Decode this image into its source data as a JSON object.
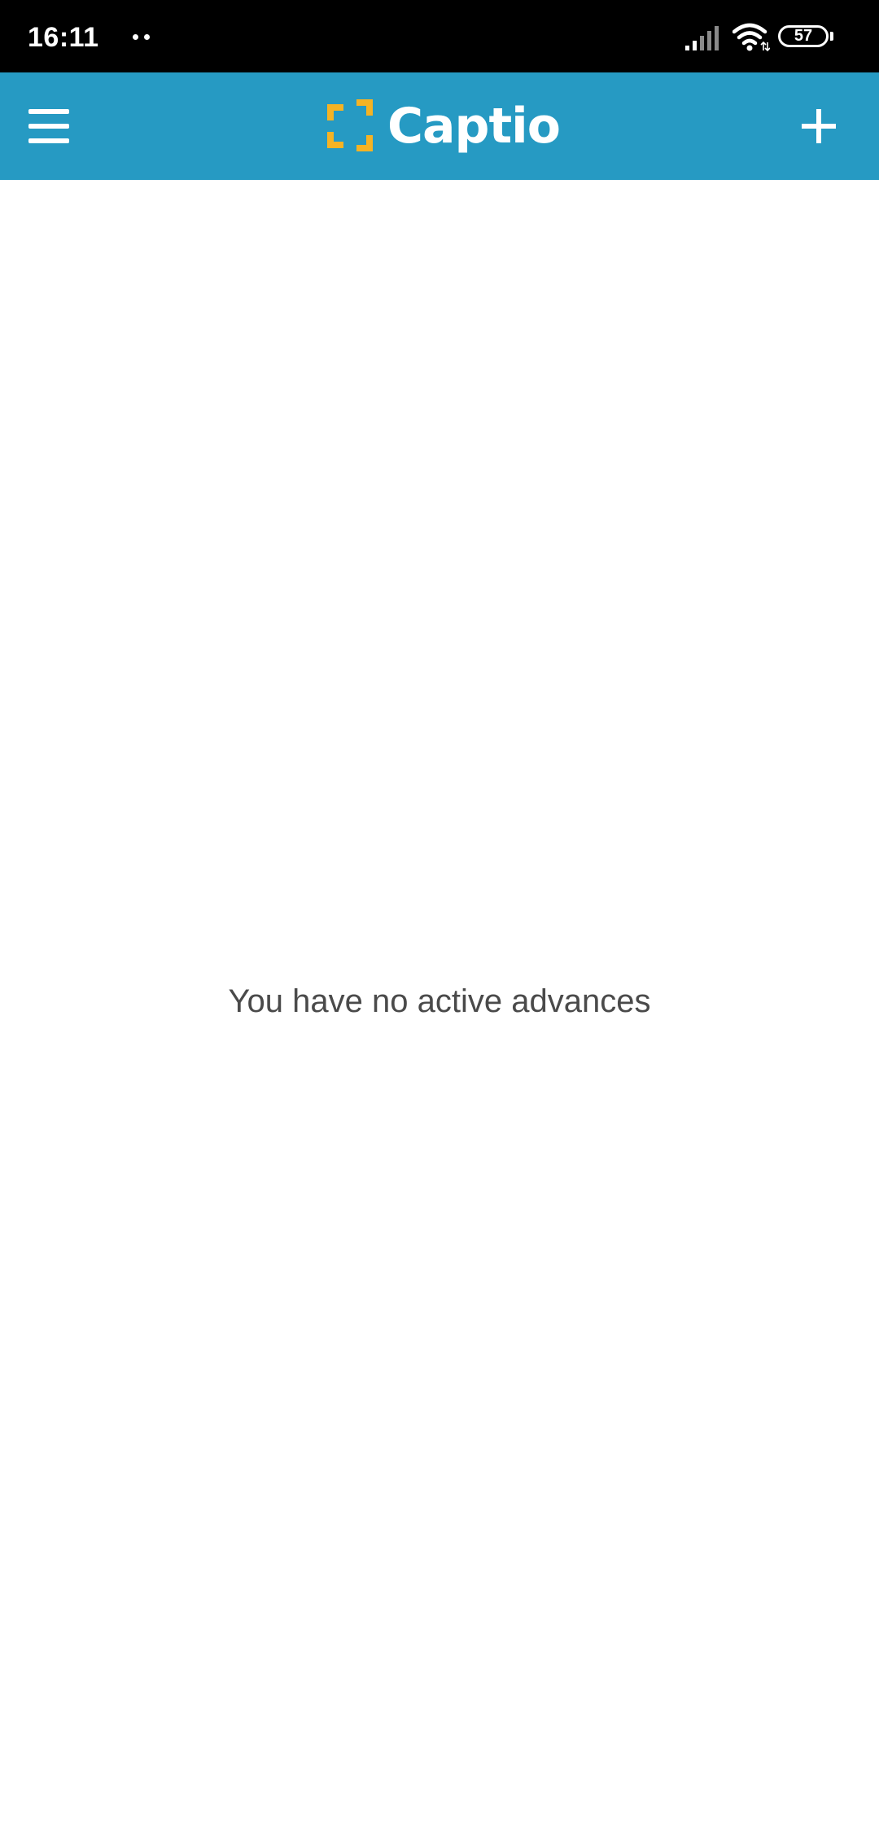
{
  "status_bar": {
    "time": "16:11",
    "battery": "57"
  },
  "app_bar": {
    "logo_text": "Captio",
    "menu_icon": "hamburger-menu-icon",
    "add_icon": "plus-icon",
    "background_color": "#269ac3",
    "logo_accent_color": "#f5b324"
  },
  "content": {
    "empty_message": "You have no active advances"
  }
}
